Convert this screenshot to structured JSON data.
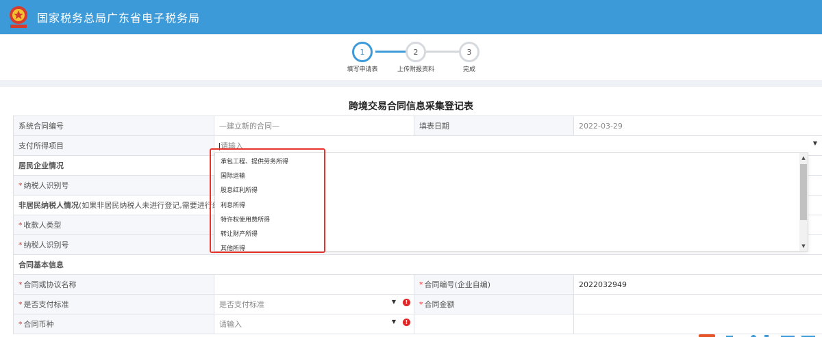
{
  "header": {
    "title": "国家税务总局广东省电子税务局"
  },
  "steps": [
    {
      "num": "1",
      "label": "填写申请表",
      "active": true
    },
    {
      "num": "2",
      "label": "上传附报资料",
      "active": false
    },
    {
      "num": "3",
      "label": "完成",
      "active": false
    }
  ],
  "form": {
    "title": "跨境交易合同信息采集登记表",
    "contract_no_label": "系统合同编号",
    "contract_no_value": "—建立新的合同—",
    "fill_date_label": "填表日期",
    "fill_date_value": "2022-03-29",
    "payment_item_label": "支付所得项目",
    "payment_item_placeholder": "请输入",
    "resident_section": "居民企业情况",
    "taxpayer_id_label": "纳税人识别号",
    "nonresident_section": "非居民纳税人情况",
    "nonresident_note": "(如果非居民纳税人未进行登记,需要进行组织临时",
    "payee_type_label": "收款人类型",
    "nonresident_taxpayer_id_label": "纳税人识别号",
    "basic_section": "合同基本信息",
    "contract_name_label": "合同或协议名称",
    "contract_own_no_label": "合同编号(企业自编)",
    "contract_own_no_value": "2022032949",
    "pay_standard_label": "是否支付标准",
    "pay_standard_placeholder": "是否支付标准",
    "contract_amount_label": "合同金额",
    "currency_label": "合同币种",
    "currency_placeholder": "请输入",
    "required_mark": "*",
    "error_mark": "!"
  },
  "dropdown": {
    "options": [
      "承包工程、提供劳务所得",
      "国际运输",
      "股息红利所得",
      "利息所得",
      "特许权使用费所得",
      "转让财产所得",
      "其他所得"
    ]
  },
  "colors": {
    "header_bg": "#3d9ad8",
    "required": "#e53333",
    "highlight": "#e8322a"
  },
  "icons": {
    "emblem": "tax-emblem-icon",
    "arrow": "chevron-down-icon",
    "error": "error-icon"
  }
}
